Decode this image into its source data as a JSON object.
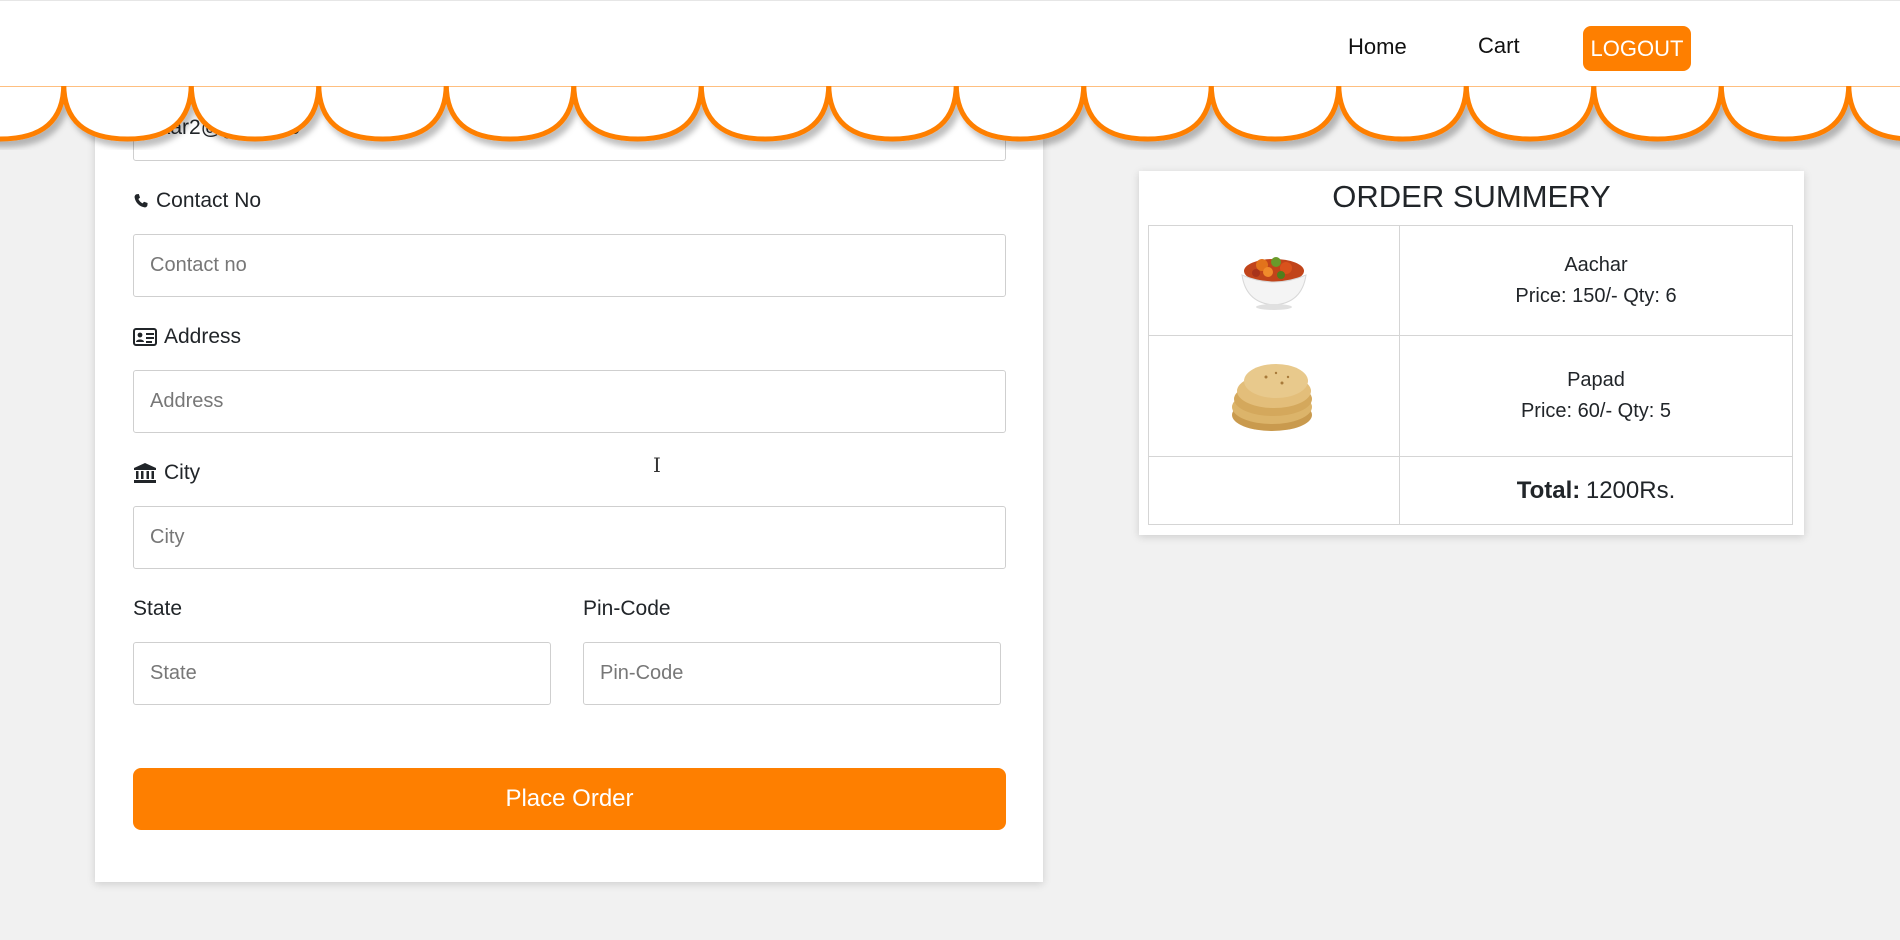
{
  "nav": {
    "home": "Home",
    "cart": "Cart",
    "logout": "LOGOUT"
  },
  "form": {
    "email_value": "jakkar2@gmail.co",
    "contact": {
      "label": "Contact No",
      "placeholder": "Contact no",
      "icon": "phone-icon"
    },
    "address": {
      "label": "Address",
      "placeholder": "Address",
      "icon": "id-card-icon"
    },
    "city": {
      "label": "City",
      "placeholder": "City",
      "icon": "bank-icon"
    },
    "state": {
      "label": "State",
      "placeholder": "State"
    },
    "pincode": {
      "label": "Pin-Code",
      "placeholder": "Pin-Code"
    },
    "submit_label": "Place Order"
  },
  "summary": {
    "title": "ORDER SUMMERY",
    "items": [
      {
        "name": "Aachar",
        "meta": "Price: 150/- Qty: 6",
        "image": "pickle-bowl-image"
      },
      {
        "name": "Papad",
        "meta": "Price: 60/- Qty: 5",
        "image": "papad-stack-image"
      }
    ],
    "total_label": "Total:",
    "total_value": "1200Rs."
  },
  "colors": {
    "accent": "#fe7f00",
    "background": "#f1f1f1",
    "card": "#ffffff"
  }
}
